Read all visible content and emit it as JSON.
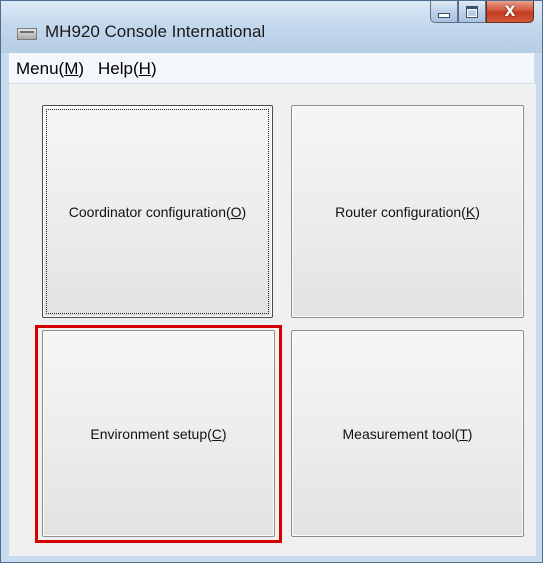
{
  "window": {
    "title": "MH920 Console International",
    "close_glyph": "X"
  },
  "menu": {
    "items": [
      {
        "prefix": "Menu(",
        "mnemonic": "M",
        "suffix": ")"
      },
      {
        "prefix": "Help(",
        "mnemonic": "H",
        "suffix": ")"
      }
    ]
  },
  "buttons": {
    "coordinator": {
      "prefix": "Coordinator configuration(",
      "mnemonic": "O",
      "suffix": ")"
    },
    "router": {
      "prefix": "Router configuration(",
      "mnemonic": "K",
      "suffix": ")"
    },
    "environment": {
      "prefix": "Environment setup(",
      "mnemonic": "C",
      "suffix": ")"
    },
    "measurement": {
      "prefix": "Measurement tool(",
      "mnemonic": "T",
      "suffix": ")"
    }
  },
  "highlight_color": "#d20000"
}
